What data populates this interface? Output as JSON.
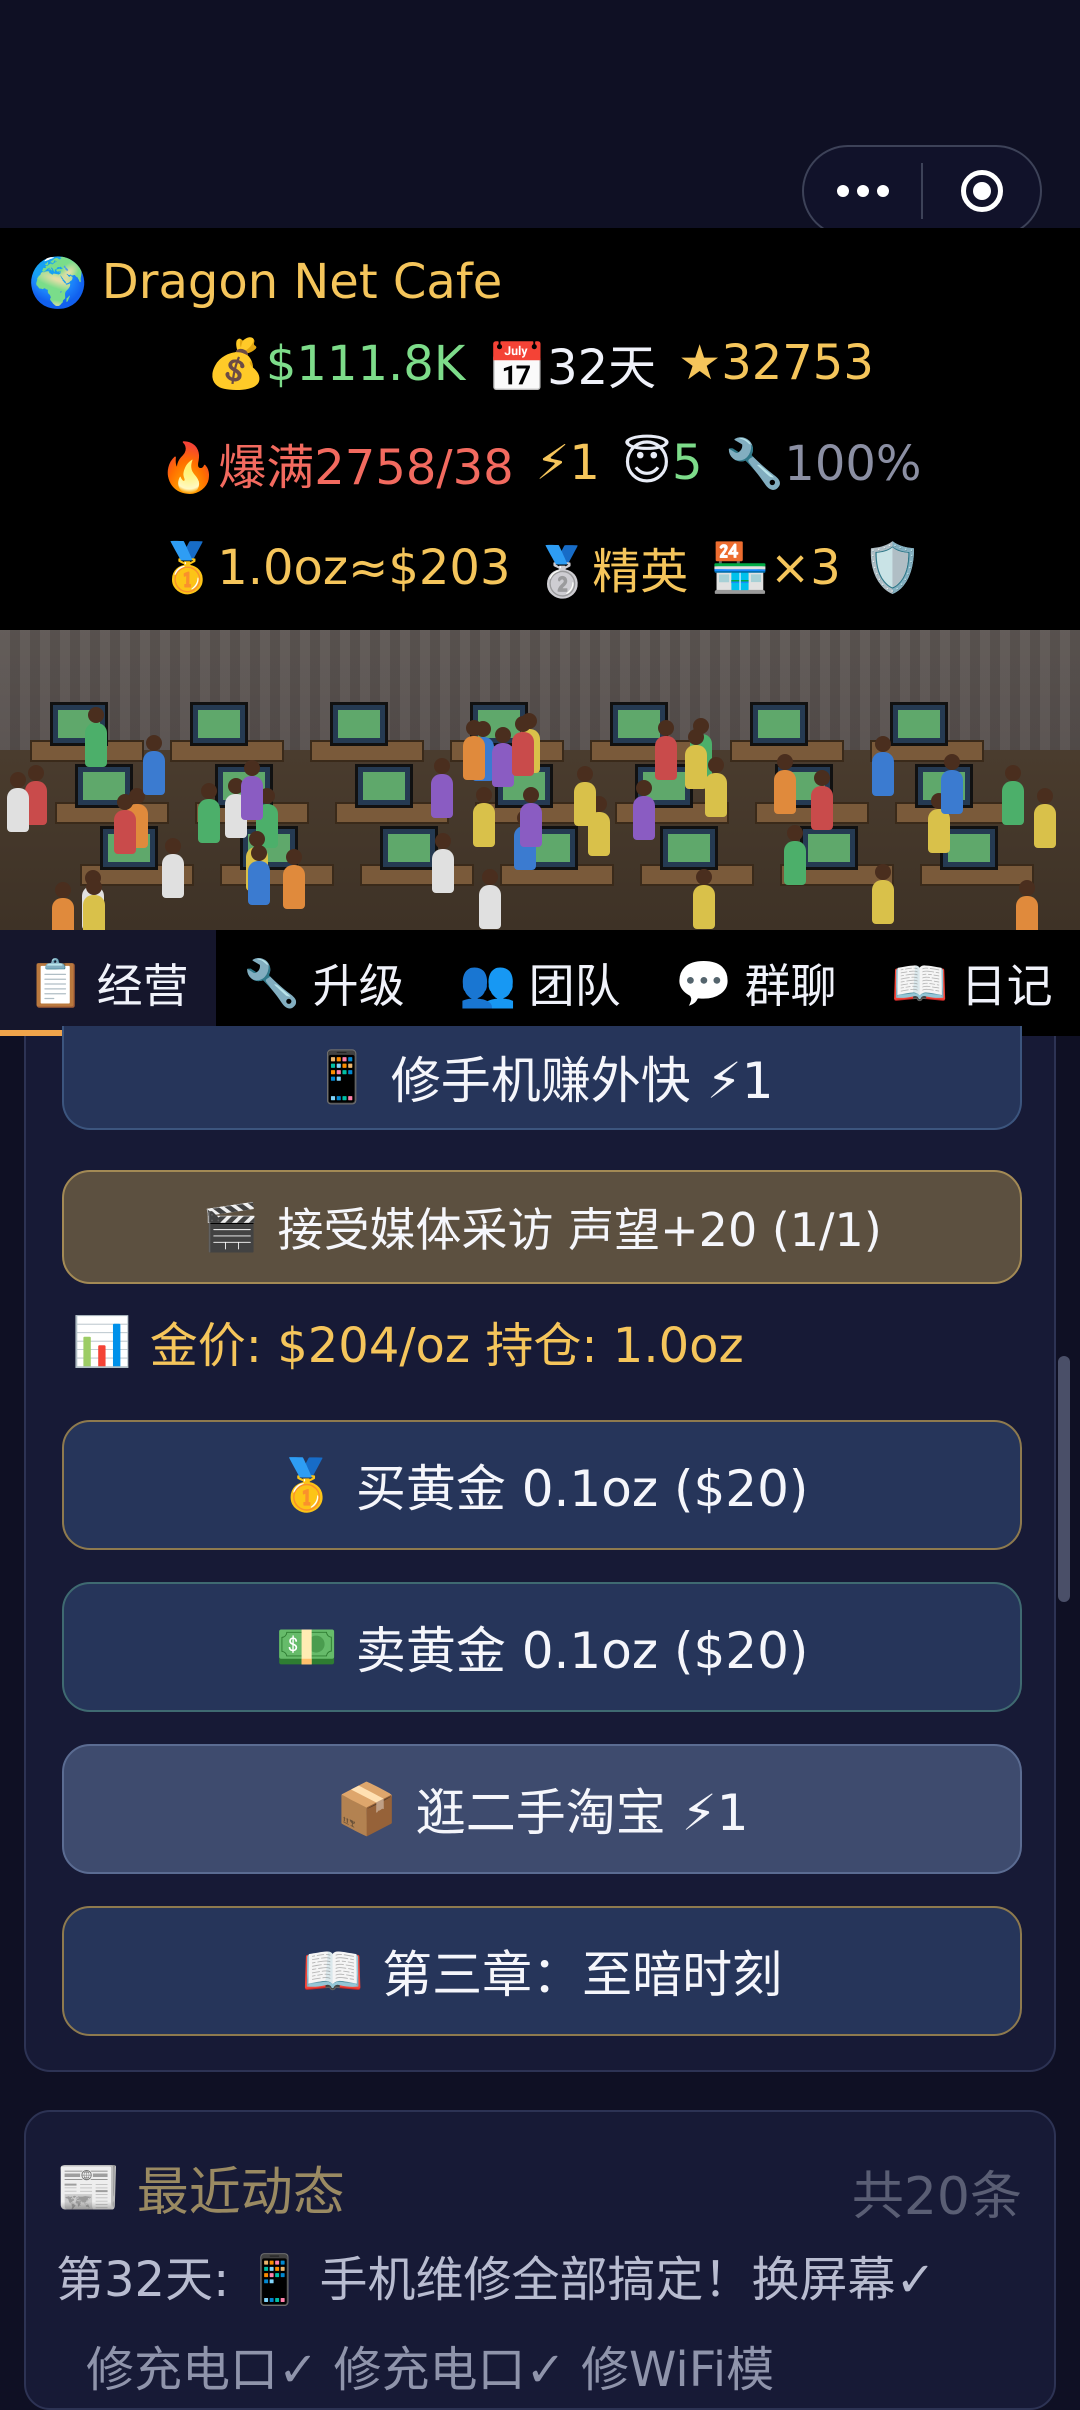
{
  "header": {
    "title": "Dragon Net Cafe",
    "money": "$111.8K",
    "days": "32天",
    "stars": "32753",
    "status": "爆满2758/38",
    "energy": "1",
    "karma": "5",
    "repair": "100%",
    "gold_holding": "1.0oz≈$203",
    "rank": "精英",
    "stores": "×3"
  },
  "tabs": [
    {
      "label": "经营",
      "icon": "clipboard-icon",
      "active": true
    },
    {
      "label": "升级",
      "icon": "wrench-icon"
    },
    {
      "label": "团队",
      "icon": "people-icon"
    },
    {
      "label": "群聊",
      "icon": "chat-icon"
    },
    {
      "label": "日记",
      "icon": "book-icon"
    }
  ],
  "actions": {
    "repair_phone": "修手机赚外快 ⚡1",
    "media_interview": "接受媒体采访 声望+20 (1/1)",
    "gold_info": "金价: $204/oz  持仓: 1.0oz",
    "buy_gold": "买黄金 0.1oz ($20)",
    "sell_gold": "卖黄金 0.1oz ($20)",
    "secondhand": "逛二手淘宝 ⚡1",
    "chapter": "第三章：至暗时刻"
  },
  "news": {
    "title": "最近动态",
    "count": "共20条",
    "line1": "第32天: 📱 手机维修全部搞定！换屏幕✓",
    "line2": "修充电口✓ 修充电口✓ 修WiFi模"
  },
  "colors": {
    "accent": "#f0a44b",
    "gold": "#f5c55b",
    "money": "#7ddc8a",
    "alert": "#f26a5f"
  }
}
